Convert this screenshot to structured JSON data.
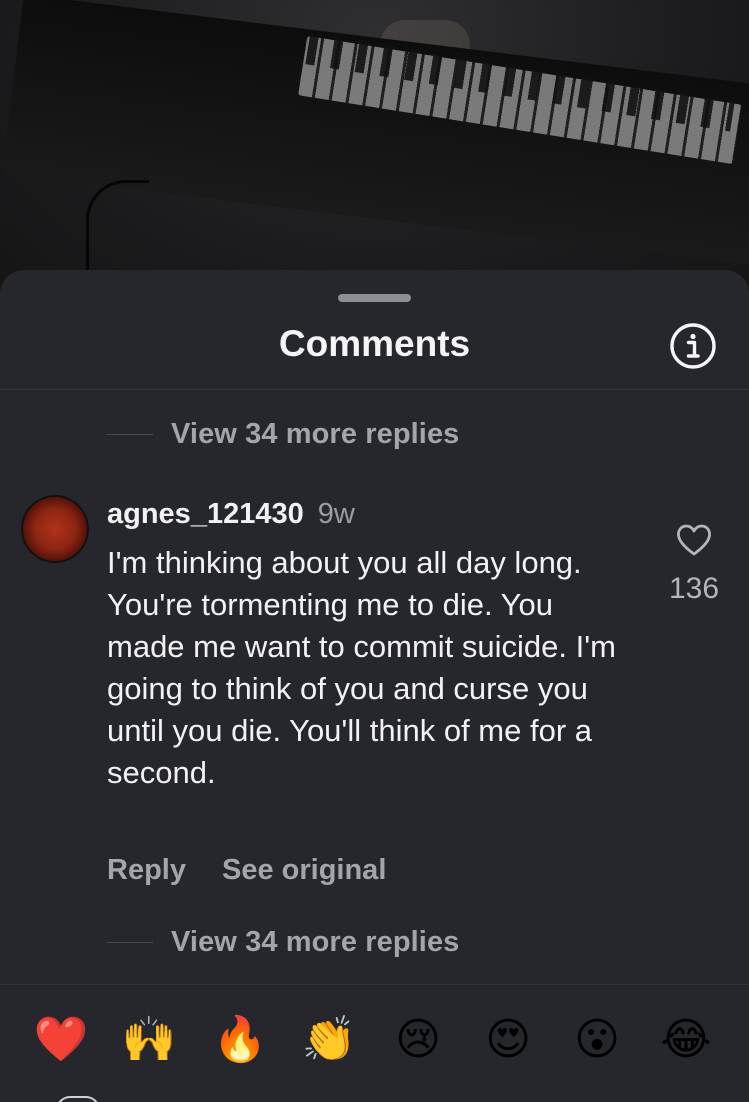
{
  "sheet": {
    "title": "Comments"
  },
  "replies_top": {
    "label": "View 34 more replies"
  },
  "comment": {
    "username": "agnes_121430",
    "time": "9w",
    "text": "I'm thinking about you all day long. You're tormenting me to die. You made me want to commit suicide. I'm going to think of you and curse you until you die. You'll think of me for a second.",
    "like_count": "136",
    "reply_label": "Reply",
    "see_original_label": "See original"
  },
  "replies_bottom": {
    "label": "View 34 more replies"
  },
  "reactions": [
    {
      "name": "red-heart",
      "emoji": "❤️"
    },
    {
      "name": "raising-hands",
      "emoji": "🙌"
    },
    {
      "name": "fire",
      "emoji": "🔥"
    },
    {
      "name": "clapping-hands",
      "emoji": "👏"
    },
    {
      "name": "crying-face",
      "emoji": "😢"
    },
    {
      "name": "heart-eyes",
      "emoji": "😍"
    },
    {
      "name": "astonished-face",
      "emoji": "😮"
    },
    {
      "name": "tears-of-joy",
      "emoji": "😂"
    }
  ],
  "icons": {
    "info": "info-circle-icon",
    "like": "heart-outline-icon"
  },
  "colors": {
    "sheet_background": "#25272c",
    "primary_text": "#f2f2f4",
    "secondary_text": "#a3a5ab"
  }
}
